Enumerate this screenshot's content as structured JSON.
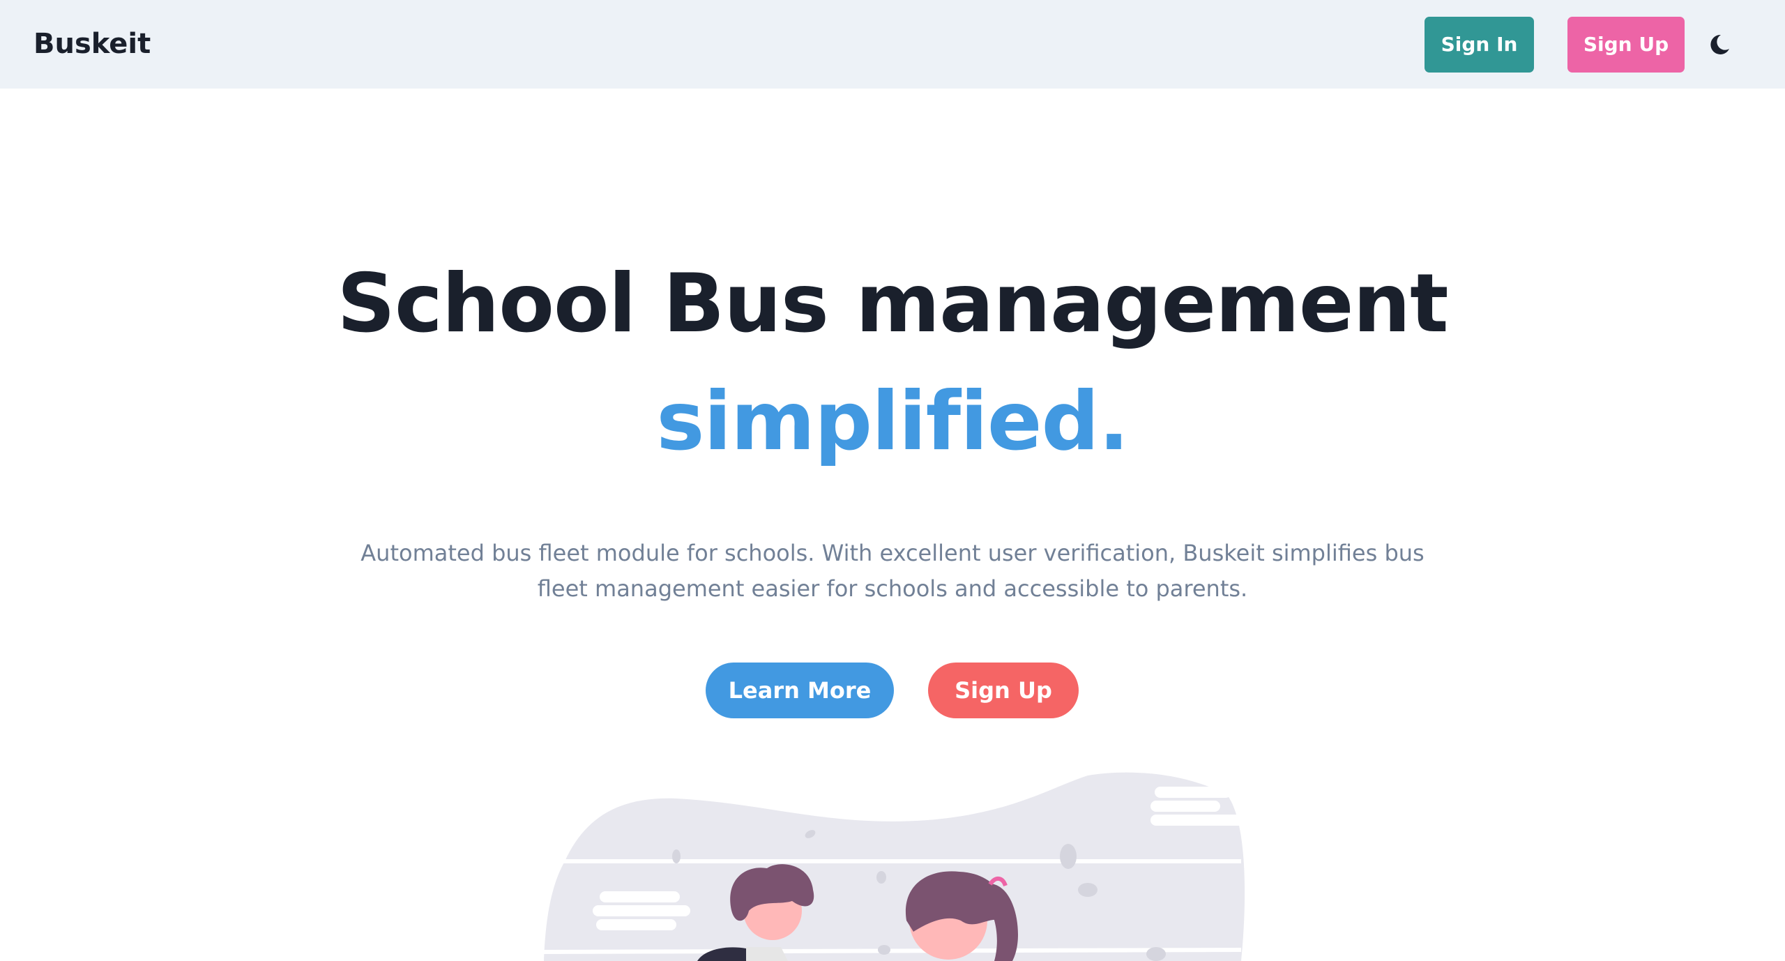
{
  "navbar": {
    "brand": "Buskeit",
    "signin_label": "Sign In",
    "signup_label": "Sign Up",
    "theme_icon": "moon-icon"
  },
  "hero": {
    "title_line1": "School Bus management",
    "title_line2": "simplified.",
    "description": "Automated bus fleet module for schools. With excellent user verification, Buskeit simplifies bus fleet management easier for schools and accessible to parents.",
    "learn_more_label": "Learn More",
    "signup_label": "Sign Up"
  },
  "colors": {
    "navbar_bg": "#edf2f7",
    "signin": "#319795",
    "signup_nav": "#ed64a6",
    "accent_blue": "#4299e1",
    "signup_cta": "#f56565",
    "heading": "#1a202c",
    "body_text": "#718096"
  }
}
